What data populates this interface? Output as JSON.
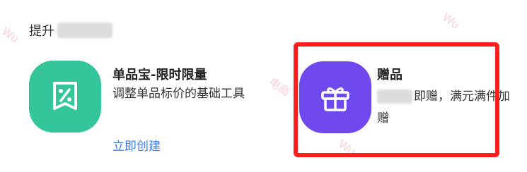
{
  "section": {
    "title": "提升"
  },
  "cards": [
    {
      "title": "单品宝-限时限量",
      "description": "调整单品标价的基础工具",
      "link": "立即创建",
      "icon": "percent-tag-icon",
      "color": "#35c59b"
    },
    {
      "title": "赠品",
      "description": "即赠，满元满件加赠",
      "icon": "gift-icon",
      "color": "#6f48ee"
    }
  ],
  "annotation": {
    "highlight_color": "#ff1d1d"
  },
  "watermarks": [
    "Wu",
    "Wu",
    "电商",
    "Wu"
  ]
}
